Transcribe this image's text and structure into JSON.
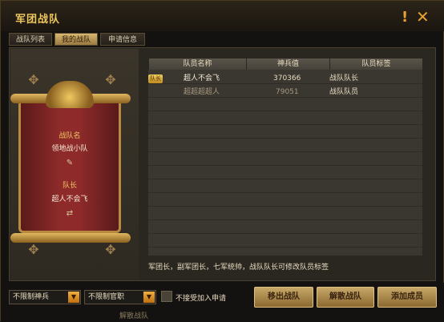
{
  "window": {
    "title": "军团战队"
  },
  "tabs": [
    {
      "label": "战队列表"
    },
    {
      "label": "我的战队"
    },
    {
      "label": "申请信息"
    }
  ],
  "team_card": {
    "team_name_label": "战队名",
    "team_name": "领地战小队",
    "leader_label": "队长",
    "leader_name": "超人不会飞"
  },
  "member_table": {
    "headers": [
      "队员名称",
      "神兵值",
      "队员标签"
    ],
    "rows": [
      {
        "badge": "队长",
        "name": "超人不会飞",
        "power": "370366",
        "tag": "战队队长"
      },
      {
        "badge": "",
        "name": "超超超超人",
        "power": "79051",
        "tag": "战队队员"
      }
    ]
  },
  "note": "军团长，副军团长，七军统帅，战队队长可修改队员标签",
  "filters": {
    "weapon_select": "不限制神兵",
    "rank_select": "不限制官职",
    "no_apply_label": "不接受加入申请"
  },
  "buttons": {
    "leave": "移出战队",
    "disband": "解散战队",
    "add": "添加成员"
  },
  "footer_text": "解散战队",
  "colors": {
    "accent": "#f0c860",
    "panel": "#2a2620",
    "scroll_red": "#8e2a2a"
  }
}
